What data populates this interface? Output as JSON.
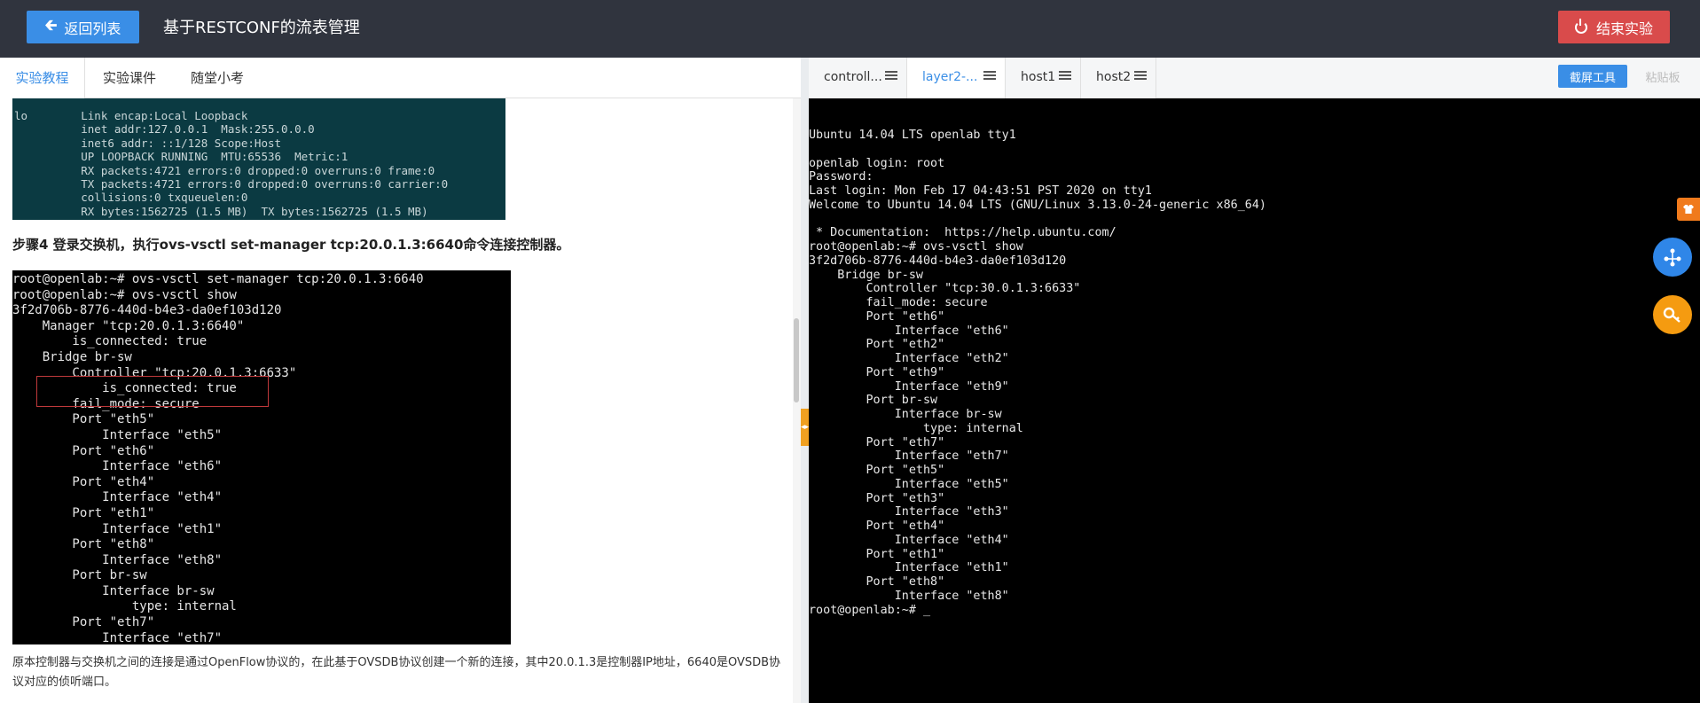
{
  "header": {
    "back_label": "返回列表",
    "title": "基于RESTCONF的流表管理",
    "end_label": "结束实验"
  },
  "left": {
    "tabs": [
      {
        "label": "实验教程"
      },
      {
        "label": "实验课件"
      },
      {
        "label": "随堂小考"
      }
    ],
    "terminal1": "lo        Link encap:Local Loopback\n          inet addr:127.0.0.1  Mask:255.0.0.0\n          inet6 addr: ::1/128 Scope:Host\n          UP LOOPBACK RUNNING  MTU:65536  Metric:1\n          RX packets:4721 errors:0 dropped:0 overruns:0 frame:0\n          TX packets:4721 errors:0 dropped:0 overruns:0 carrier:0\n          collisions:0 txqueuelen:0\n          RX bytes:1562725 (1.5 MB)  TX bytes:1562725 (1.5 MB)",
    "step": "步骤4 登录交换机，执行ovs-vsctl set-manager tcp:20.0.1.3:6640命令连接控制器。",
    "terminal2": "root@openlab:~# ovs-vsctl set-manager tcp:20.0.1.3:6640\nroot@openlab:~# ovs-vsctl show\n3f2d706b-8776-440d-b4e3-da0ef103d120\n    Manager \"tcp:20.0.1.3:6640\"\n        is_connected: true\n    Bridge br-sw\n        Controller \"tcp:20.0.1.3:6633\"\n            is_connected: true\n        fail_mode: secure\n        Port \"eth5\"\n            Interface \"eth5\"\n        Port \"eth6\"\n            Interface \"eth6\"\n        Port \"eth4\"\n            Interface \"eth4\"\n        Port \"eth1\"\n            Interface \"eth1\"\n        Port \"eth8\"\n            Interface \"eth8\"\n        Port br-sw\n            Interface br-sw\n                type: internal\n        Port \"eth7\"\n            Interface \"eth7\"",
    "paragraph": "原本控制器与交换机之间的连接是通过OpenFlow协议的，在此基于OVSDB协议创建一个新的连接，其中20.0.1.3是控制器IP地址，6640是OVSDB协议对应的侦听端口。"
  },
  "right": {
    "tabs": [
      {
        "label": "controll..."
      },
      {
        "label": "layer2-..."
      },
      {
        "label": "host1"
      },
      {
        "label": "host2"
      }
    ],
    "active_tab": "layer2-...",
    "screenshot_label": "截屏工具",
    "paste_label": "粘贴板",
    "terminal": "Ubuntu 14.04 LTS openlab tty1\n\nopenlab login: root\nPassword:\nLast login: Mon Feb 17 04:43:51 PST 2020 on tty1\nWelcome to Ubuntu 14.04 LTS (GNU/Linux 3.13.0-24-generic x86_64)\n\n * Documentation:  https://help.ubuntu.com/\nroot@openlab:~# ovs-vsctl show\n3f2d706b-8776-440d-b4e3-da0ef103d120\n    Bridge br-sw\n        Controller \"tcp:30.0.1.3:6633\"\n        fail_mode: secure\n        Port \"eth6\"\n            Interface \"eth6\"\n        Port \"eth2\"\n            Interface \"eth2\"\n        Port \"eth9\"\n            Interface \"eth9\"\n        Port br-sw\n            Interface br-sw\n                type: internal\n        Port \"eth7\"\n            Interface \"eth7\"\n        Port \"eth5\"\n            Interface \"eth5\"\n        Port \"eth3\"\n            Interface \"eth3\"\n        Port \"eth4\"\n            Interface \"eth4\"\n        Port \"eth1\"\n            Interface \"eth1\"\n        Port \"eth8\"\n            Interface \"eth8\"\nroot@openlab:~# _"
  },
  "icons": {
    "back": "arrow-left-icon",
    "end": "power-icon",
    "tab_menu": "menu-lines-icon",
    "side_tag": "shirt-icon",
    "float_blue": "network-icon",
    "float_orange": "key-icon"
  },
  "colors": {
    "topbar": "#30343e",
    "primary": "#3a8ee6",
    "danger": "#d94b4b",
    "accent_orange": "#f59b10"
  }
}
